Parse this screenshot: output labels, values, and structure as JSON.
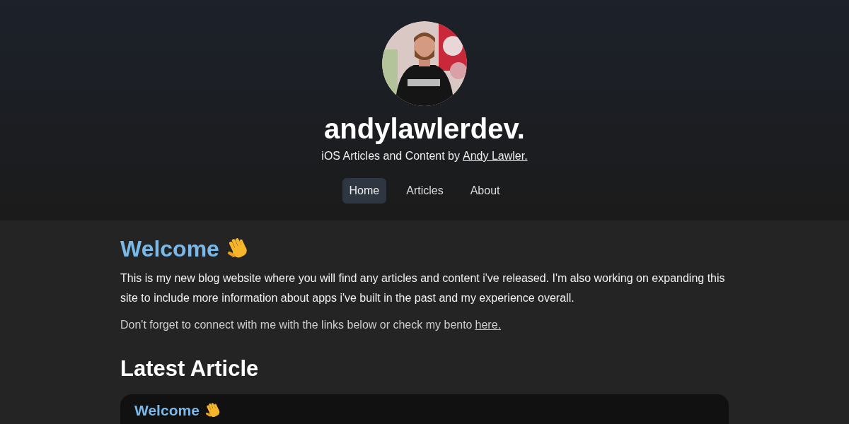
{
  "header": {
    "site_title": "andylawlerdev.",
    "tagline": {
      "text": "iOS Articles and Content by",
      "link": "Andy Lawler."
    },
    "nav": [
      {
        "label": "Home",
        "selected": true
      },
      {
        "label": "Articles",
        "selected": false
      },
      {
        "label": "About",
        "selected": false
      }
    ]
  },
  "welcome": {
    "heading": "Welcome",
    "intro": "This is my new blog website where you will find any articles and content i've released. I'm also working on expanding this site to include more information about apps i've built in the past and my experience overall.",
    "connect": {
      "text": "Don't forget to connect with me with the links below or check my bento",
      "link": "here."
    }
  },
  "latest": {
    "heading": "Latest Article",
    "card": {
      "title": "Welcome"
    }
  }
}
